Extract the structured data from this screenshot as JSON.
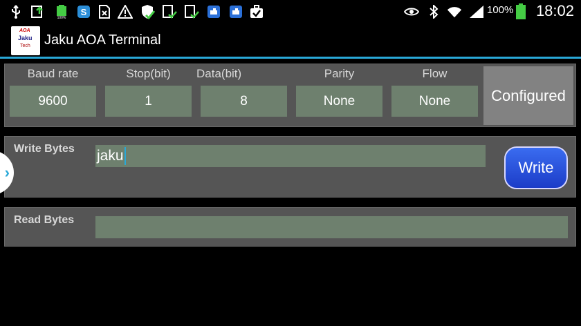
{
  "status_bar": {
    "battery_percent": "100%",
    "time": "18:02",
    "left_icons": [
      "usb-icon",
      "upload-icon",
      "battery-full-small-icon",
      "skype-icon",
      "sim-card-icon",
      "warning-icon",
      "shield-check-icon",
      "clipboard-check-icon",
      "clipboard-check-icon",
      "puzzle-icon",
      "puzzle-icon",
      "briefcase-check-icon"
    ],
    "right_icons": [
      "eye-icon",
      "bluetooth-icon",
      "wifi-icon",
      "signal-icon",
      "battery-icon"
    ]
  },
  "action_bar": {
    "title": "Jaku AOA Terminal",
    "logo": {
      "line1": "AOA",
      "line2": "Jaku",
      "line3": "Tech"
    }
  },
  "config": {
    "columns": [
      {
        "label": "Baud rate",
        "value": "9600"
      },
      {
        "label": "Stop(bit)",
        "value": "1"
      },
      {
        "label": "Data(bit)",
        "value": "8"
      },
      {
        "label": "Parity",
        "value": "None"
      },
      {
        "label": "Flow",
        "value": "None"
      }
    ],
    "button_label": "Configured"
  },
  "write": {
    "label": "Write Bytes",
    "input_value": "jaku",
    "button_label": "Write"
  },
  "read": {
    "label": "Read Bytes",
    "output_value": ""
  },
  "drawer": {
    "icon": "chevron-right-icon"
  },
  "colors": {
    "accent": "#29a8d8",
    "panel": "#555555",
    "field": "#6e806e",
    "write_button": "#2a50e0"
  }
}
